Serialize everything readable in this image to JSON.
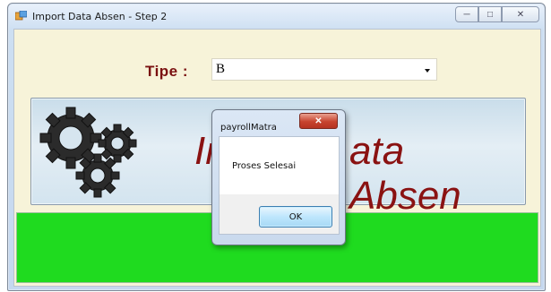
{
  "window": {
    "title": "Import Data Absen - Step 2",
    "icon": "app-icon"
  },
  "form": {
    "tipe_label": "Tipe  :",
    "tipe_value": "B"
  },
  "banner": {
    "text_left": "Im",
    "text_right": "ata Absen",
    "icon": "gears-icon",
    "text_color": "#8a1212"
  },
  "status_bar": {
    "color": "#1fdb1f"
  },
  "dialog": {
    "title": "payrollMatra",
    "message": "Proses Selesai",
    "ok_label": "OK"
  }
}
